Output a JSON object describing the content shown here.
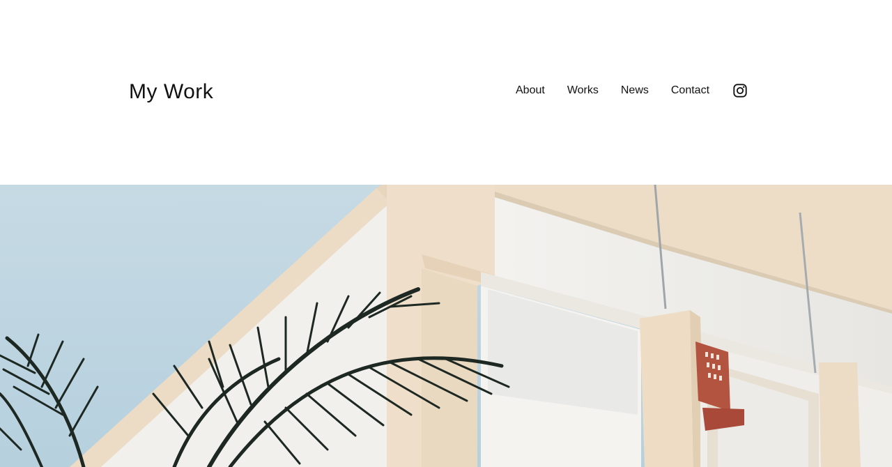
{
  "site": {
    "title": "My Work"
  },
  "nav": {
    "items": [
      {
        "label": "About"
      },
      {
        "label": "Works"
      },
      {
        "label": "News"
      },
      {
        "label": "Contact"
      }
    ],
    "social_icon": "instagram-icon"
  },
  "hero": {
    "image_subject": "building-with-palm-photo"
  },
  "colors": {
    "text": "#111111",
    "background": "#ffffff",
    "sky": "#c4dae6",
    "building": "#efe0cc",
    "palm": "#1f2a24"
  }
}
